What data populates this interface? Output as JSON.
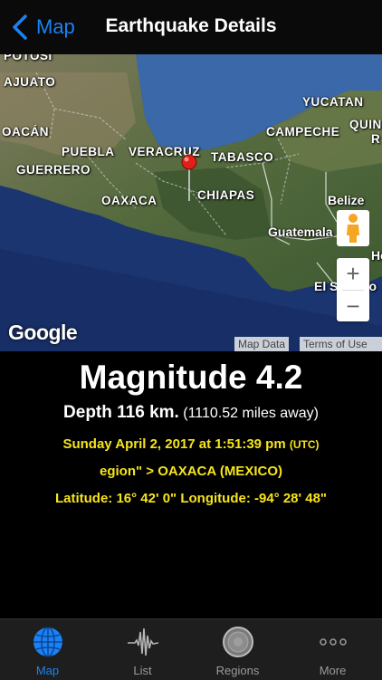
{
  "nav": {
    "back_label": "Map",
    "title": "Earthquake Details"
  },
  "map": {
    "places": {
      "potosi": "POTOSÍ",
      "guanajuato": "AJUATO",
      "michoacan": "OACÁN",
      "puebla": "PUEBLA",
      "veracruz": "VERACRUZ",
      "tabasco": "TABASCO",
      "guerrero": "GUERRERO",
      "oaxaca": "OAXACA",
      "chiapas": "CHIAPAS",
      "yucatan": "YUCATAN",
      "campeche": "CAMPECHE",
      "quintana": "QUIN",
      "r": "R",
      "belize": "Belize",
      "guatemala": "Guatemala",
      "honduras": "Ho",
      "elsalvador": "El S",
      "salvador_rest": "do"
    },
    "logo": "Google",
    "map_data_label": "Map Data",
    "terms_label": "Terms of Use",
    "zoom_in": "+",
    "zoom_out": "−"
  },
  "quake": {
    "magnitude": "Magnitude 4.2",
    "depth": "Depth 116 km.",
    "distance": "(1110.52 miles away)",
    "datetime": "Sunday April 2, 2017 at 1:51:39 pm",
    "tz": "(UTC)",
    "region": "egion\" > OAXACA (MEXICO)",
    "coords": "Latitude: 16° 42' 0\" Longitude: -94° 28' 48\""
  },
  "tabs": [
    {
      "label": "Map",
      "icon": "globe-icon"
    },
    {
      "label": "List",
      "icon": "seismograph-icon"
    },
    {
      "label": "Regions",
      "icon": "radar-icon"
    },
    {
      "label": "More",
      "icon": "more-dots-icon"
    }
  ],
  "colors": {
    "accent": "#1a82f5",
    "highlight": "#f6e51c",
    "pin": "#e0201a"
  }
}
